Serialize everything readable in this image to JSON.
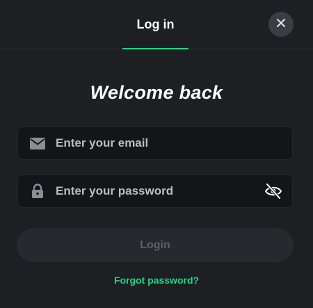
{
  "header": {
    "tab_label": "Log in",
    "close_icon": "close-icon"
  },
  "main": {
    "title": "Welcome back",
    "email": {
      "icon": "mail-icon",
      "placeholder": "Enter your email",
      "value": ""
    },
    "password": {
      "icon": "lock-icon",
      "placeholder": "Enter your password",
      "value": "",
      "toggle_icon": "eye-off-icon"
    },
    "login_label": "Login",
    "forgot_label": "Forgot password?"
  },
  "colors": {
    "background": "#1d1f23",
    "accent": "#1bd68b",
    "field_bg": "#141518",
    "button_bg": "#26292d",
    "button_text": "#5d6166"
  }
}
